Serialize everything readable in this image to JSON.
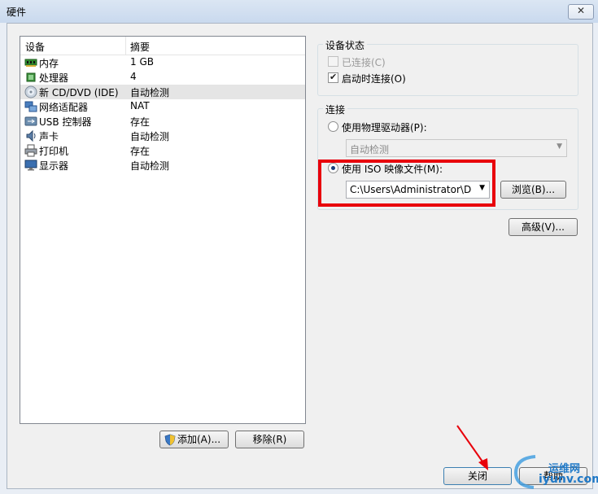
{
  "window": {
    "title": "硬件",
    "close_glyph": "✕"
  },
  "device_list": {
    "headers": {
      "device": "设备",
      "summary": "摘要"
    },
    "rows": [
      {
        "name": "内存",
        "summary": "1 GB",
        "icon": "memory-icon"
      },
      {
        "name": "处理器",
        "summary": "4",
        "icon": "processor-icon"
      },
      {
        "name": "新 CD/DVD (IDE)",
        "summary": "自动检测",
        "icon": "cd-dvd-icon",
        "selected": true
      },
      {
        "name": "网络适配器",
        "summary": "NAT",
        "icon": "network-adapter-icon"
      },
      {
        "name": "USB 控制器",
        "summary": "存在",
        "icon": "usb-icon"
      },
      {
        "name": "声卡",
        "summary": "自动检测",
        "icon": "sound-card-icon"
      },
      {
        "name": "打印机",
        "summary": "存在",
        "icon": "printer-icon"
      },
      {
        "name": "显示器",
        "summary": "自动检测",
        "icon": "display-icon"
      }
    ]
  },
  "list_buttons": {
    "add": "添加(A)...",
    "remove": "移除(R)"
  },
  "device_status": {
    "title": "设备状态",
    "connected": {
      "label": "已连接(C)",
      "checked": false,
      "disabled": true
    },
    "connect_at_power_on": {
      "label": "启动时连接(O)",
      "checked": true
    }
  },
  "connection": {
    "title": "连接",
    "physical_drive": {
      "label": "使用物理驱动器(P):",
      "selected": false
    },
    "physical_drive_combo": "自动检测",
    "iso_image": {
      "label": "使用 ISO 映像文件(M):",
      "selected": true
    },
    "iso_path": "C:\\Users\\Administrator\\Desk",
    "browse": "浏览(B)..."
  },
  "advanced": "高级(V)...",
  "footer": {
    "close": "关闭",
    "help": "帮助"
  },
  "watermark": {
    "line1": "运维网",
    "line2": "iyunv.com"
  },
  "colors": {
    "highlight": "#e8000b",
    "annotation_arrow": "#e8000b"
  }
}
